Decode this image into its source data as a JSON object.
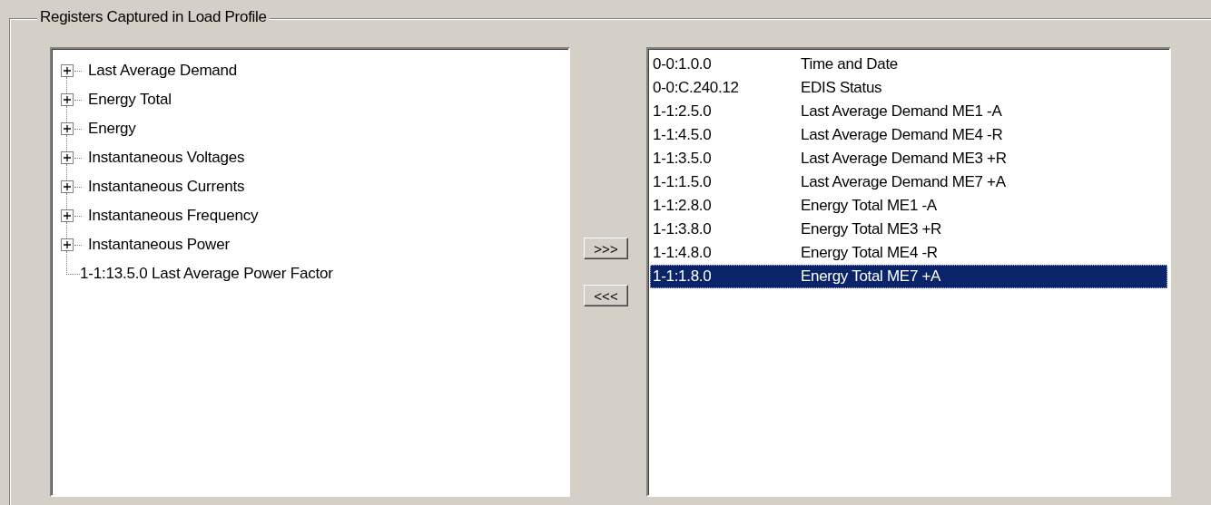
{
  "group": {
    "title": "Registers Captured in Load Profile"
  },
  "tree": {
    "items": [
      {
        "kind": "node",
        "label": "Last Average Demand",
        "expanded": false
      },
      {
        "kind": "node",
        "label": "Energy Total",
        "expanded": false
      },
      {
        "kind": "node",
        "label": "Energy",
        "expanded": false
      },
      {
        "kind": "node",
        "label": "Instantaneous Voltages",
        "expanded": false
      },
      {
        "kind": "node",
        "label": "Instantaneous Currents",
        "expanded": false
      },
      {
        "kind": "node",
        "label": "Instantaneous Frequency",
        "expanded": false
      },
      {
        "kind": "node",
        "label": "Instantaneous Power",
        "expanded": false
      },
      {
        "kind": "leaf",
        "label": "1-1:13.5.0 Last Average Power Factor"
      }
    ]
  },
  "buttons": [
    ">>>",
    "<<<"
  ],
  "list": {
    "rows": [
      {
        "code": "0-0:1.0.0",
        "name": "Time and Date",
        "selected": false
      },
      {
        "code": "0-0:C.240.12",
        "name": "EDIS Status",
        "selected": false
      },
      {
        "code": "1-1:2.5.0",
        "name": "Last Average Demand ME1 -A",
        "selected": false
      },
      {
        "code": "1-1:4.5.0",
        "name": "Last Average Demand ME4 -R",
        "selected": false
      },
      {
        "code": "1-1:3.5.0",
        "name": "Last Average Demand ME3 +R",
        "selected": false
      },
      {
        "code": "1-1:1.5.0",
        "name": "Last Average Demand ME7 +A",
        "selected": false
      },
      {
        "code": "1-1:2.8.0",
        "name": "Energy Total ME1 -A",
        "selected": false
      },
      {
        "code": "1-1:3.8.0",
        "name": "Energy Total ME3 +R",
        "selected": false
      },
      {
        "code": "1-1:4.8.0",
        "name": "Energy Total ME4 -R",
        "selected": false
      },
      {
        "code": "1-1:1.8.0",
        "name": "Energy Total ME7 +A",
        "selected": true
      }
    ]
  }
}
